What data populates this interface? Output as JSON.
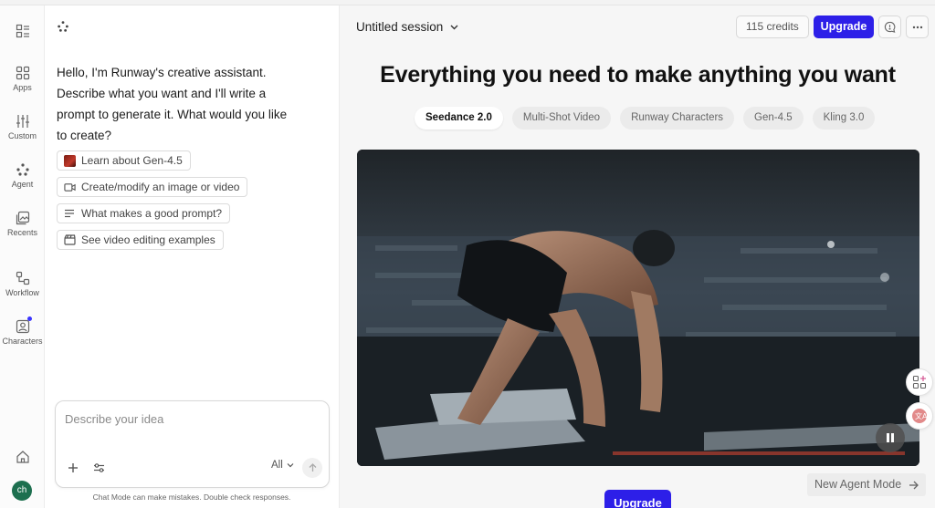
{
  "rail": {
    "items": [
      {
        "label": ""
      },
      {
        "label": "Apps"
      },
      {
        "label": "Custom"
      },
      {
        "label": "Agent"
      },
      {
        "label": "Recents"
      },
      {
        "label": "Workflow"
      },
      {
        "label": "Characters"
      }
    ],
    "avatar_initials": "ch"
  },
  "chat": {
    "greeting": "Hello, I'm Runway's creative assistant. Describe what you want and I'll write a prompt to generate it. What would you like to create?",
    "suggestions": [
      {
        "label": "Learn about Gen-4.5",
        "icon": "gen-thumbnail"
      },
      {
        "label": "Create/modify an image or video",
        "icon": "video-icon"
      },
      {
        "label": "What makes a good prompt?",
        "icon": "lines-icon"
      },
      {
        "label": "See video editing examples",
        "icon": "clapperboard-icon"
      }
    ],
    "composer": {
      "placeholder": "Describe your idea",
      "filter_label": "All"
    },
    "disclaimer": "Chat Mode can make mistakes. Double check responses."
  },
  "main": {
    "session_title": "Untitled session",
    "credits": "115 credits",
    "upgrade_label": "Upgrade",
    "headline": "Everything you need to make anything you want",
    "tabs": [
      {
        "label": "Seedance 2.0",
        "active": true
      },
      {
        "label": "Multi-Shot Video",
        "active": false
      },
      {
        "label": "Runway Characters",
        "active": false
      },
      {
        "label": "Gen-4.5",
        "active": false
      },
      {
        "label": "Kling 3.0",
        "active": false
      }
    ],
    "new_agent_label": "New Agent Mode",
    "upgrade_bottom_label": "Upgrade"
  },
  "colors": {
    "accent": "#2d1fe8",
    "avatar": "#1d6f4f",
    "notification_dot": "#3b35ff"
  }
}
